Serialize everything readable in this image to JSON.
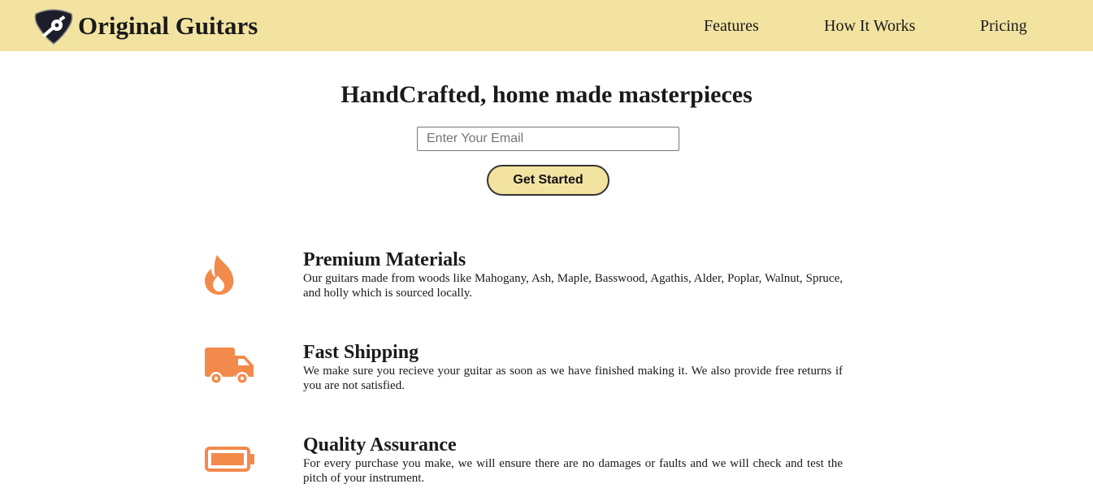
{
  "header": {
    "brand": "Original Guitars",
    "logo_icon": "guitar-pick-logo-icon",
    "nav": [
      {
        "label": "Features"
      },
      {
        "label": "How It Works"
      },
      {
        "label": "Pricing"
      }
    ]
  },
  "hero": {
    "title": "HandCrafted, home made masterpieces",
    "email_placeholder": "Enter Your Email",
    "email_value": "",
    "cta_label": "Get Started"
  },
  "features": [
    {
      "icon": "fire-icon",
      "title": "Premium Materials",
      "description": "Our guitars made from woods like Mahogany, Ash, Maple, Basswood, Agathis, Alder, Poplar, Walnut, Spruce, and holly which is sourced locally."
    },
    {
      "icon": "truck-icon",
      "title": "Fast Shipping",
      "description": "We make sure you recieve your guitar as soon as we have finished making it. We also provide free returns if you are not satisfied."
    },
    {
      "icon": "battery-full-icon",
      "title": "Quality Assurance",
      "description": "For every purchase you make, we will ensure there are no damages or faults and we will check and test the pitch of your instrument."
    }
  ],
  "colors": {
    "header_bg": "#f2e3a1",
    "accent_icon": "#f28a4b",
    "text": "#1a1a1a"
  }
}
